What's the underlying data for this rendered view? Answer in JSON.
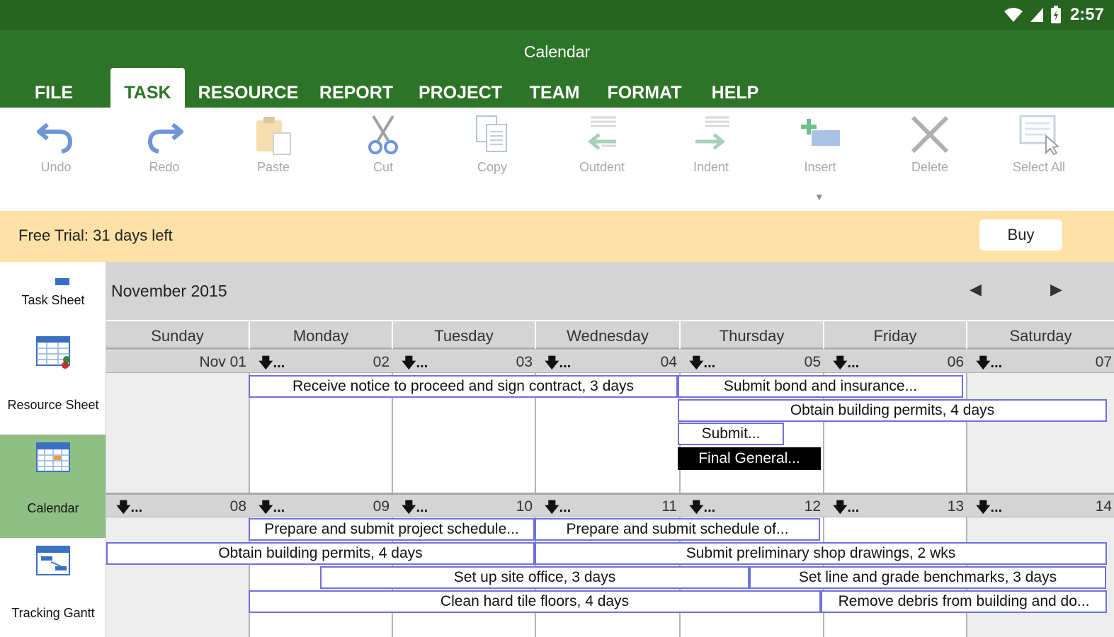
{
  "status": {
    "time": "2:57"
  },
  "app": {
    "title": "Calendar"
  },
  "ribbon_tabs": [
    {
      "label": "FILE"
    },
    {
      "label": "TASK",
      "active": true
    },
    {
      "label": "RESOURCE"
    },
    {
      "label": "REPORT"
    },
    {
      "label": "PROJECT"
    },
    {
      "label": "TEAM"
    },
    {
      "label": "FORMAT"
    },
    {
      "label": "HELP"
    }
  ],
  "toolbar": {
    "undo": "Undo",
    "redo": "Redo",
    "paste": "Paste",
    "cut": "Cut",
    "copy": "Copy",
    "outdent": "Outdent",
    "indent": "Indent",
    "insert": "Insert",
    "delete": "Delete",
    "select_all": "Select All"
  },
  "trial": {
    "text": "Free Trial: 31 days left",
    "buy_label": "Buy"
  },
  "sidenav": {
    "items": [
      {
        "label": "Task Sheet",
        "icon": "task-sheet-icon"
      },
      {
        "label": "Resource Sheet",
        "icon": "resource-sheet-icon"
      },
      {
        "label": "Calendar",
        "icon": "calendar-icon",
        "active": true
      },
      {
        "label": "Tracking Gantt",
        "icon": "tracking-gantt-icon"
      }
    ]
  },
  "calendar": {
    "month": "November 2015",
    "prev": "◀",
    "next": "▶",
    "days": [
      "Sunday",
      "Monday",
      "Tuesday",
      "Wednesday",
      "Thursday",
      "Friday",
      "Saturday"
    ],
    "weeks": [
      {
        "dates": [
          "Nov 01",
          "02",
          "03",
          "04",
          "05",
          "06",
          "07"
        ],
        "more": [
          "",
          "🡇...",
          "🡇...",
          "🡇...",
          "🡇...",
          "🡇...",
          "🡇..."
        ],
        "tasks": [
          {
            "label": "Receive notice to proceed and sign contract, 3 days"
          },
          {
            "label": "Submit bond and insurance..."
          },
          {
            "label": "Obtain building permits, 4 days"
          },
          {
            "label": "Submit..."
          },
          {
            "label": "Final General...",
            "selected": true
          }
        ]
      },
      {
        "dates": [
          "08",
          "09",
          "10",
          "11",
          "12",
          "13",
          "14"
        ],
        "more": [
          "🡇...",
          "🡇...",
          "🡇...",
          "🡇...",
          "🡇...",
          "🡇...",
          "🡇..."
        ],
        "tasks": [
          {
            "label": "Prepare and submit project schedule..."
          },
          {
            "label": "Prepare and submit schedule of..."
          },
          {
            "label": "Obtain building permits, 4 days"
          },
          {
            "label": "Submit preliminary shop drawings, 2 wks"
          },
          {
            "label": "Set up site office, 3 days"
          },
          {
            "label": "Set line and grade benchmarks, 3 days"
          },
          {
            "label": "Clean hard tile floors, 4 days"
          },
          {
            "label": "Remove debris from building and do..."
          }
        ]
      }
    ]
  }
}
